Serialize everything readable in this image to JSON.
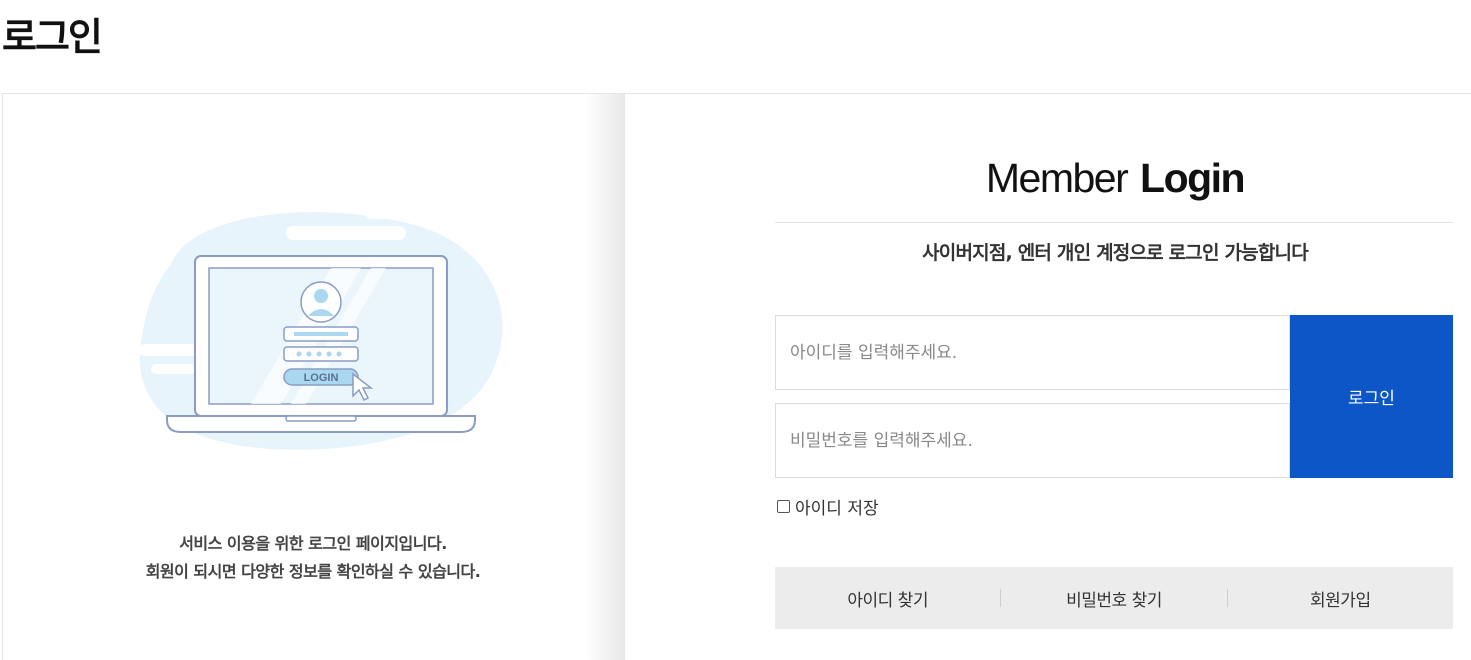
{
  "page": {
    "title": "로그인"
  },
  "left": {
    "illustration": {
      "button_text": "LOGIN"
    },
    "desc_line1": "서비스 이용을 위한 로그인 페이지입니다.",
    "desc_line2": "회원이 되시면 다양한 정보를 확인하실 수 있습니다."
  },
  "login": {
    "heading_light": "Member",
    "heading_bold": "Login",
    "subheading": "사이버지점, 엔터 개인 계정으로 로그인 가능합니다",
    "id_placeholder": "아이디를 입력해주세요.",
    "pw_placeholder": "비밀번호를 입력해주세요.",
    "submit_label": "로그인",
    "save_id_label": "아이디 저장",
    "save_id_checked": false
  },
  "links": [
    {
      "label": "아이디 찾기"
    },
    {
      "label": "비밀번호 찾기"
    },
    {
      "label": "회원가입"
    }
  ],
  "colors": {
    "accent": "#0d56c8",
    "links_bg": "#ececec",
    "illustration_light": "#e8f4fb"
  }
}
